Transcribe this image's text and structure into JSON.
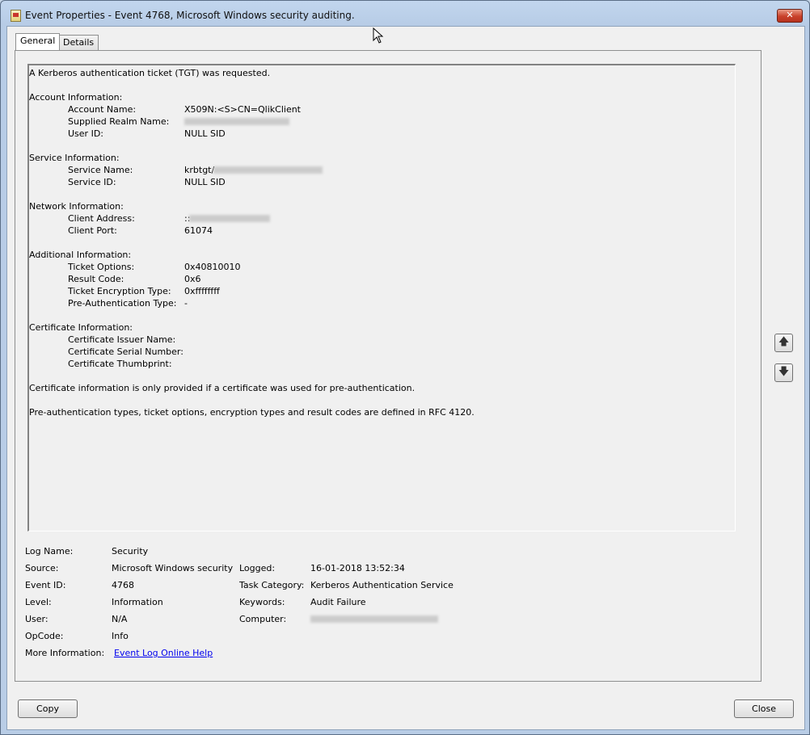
{
  "window": {
    "title": "Event Properties - Event 4768, Microsoft Windows security auditing.",
    "close_glyph": "✕"
  },
  "tabs": [
    "General",
    "Details"
  ],
  "description": {
    "intro": "A Kerberos authentication ticket (TGT) was requested.",
    "account": {
      "heading": "Account Information:",
      "account_name_label": "Account Name:",
      "account_name_value": "X509N:<S>CN=QlikClient",
      "realm_label": "Supplied Realm Name:",
      "user_id_label": "User ID:",
      "user_id_value": "NULL SID"
    },
    "service": {
      "heading": "Service Information:",
      "name_label": "Service Name:",
      "name_value_prefix": "krbtgt/",
      "id_label": "Service ID:",
      "id_value": "NULL SID"
    },
    "network": {
      "heading": "Network Information:",
      "address_label": "Client Address:",
      "address_value_prefix": "::",
      "port_label": "Client Port:",
      "port_value": "61074"
    },
    "additional": {
      "heading": "Additional Information:",
      "ticket_options_label": "Ticket Options:",
      "ticket_options_value": "0x40810010",
      "result_code_label": "Result Code:",
      "result_code_value": "0x6",
      "encryption_label": "Ticket Encryption Type:",
      "encryption_value": "0xffffffff",
      "preauth_label": "Pre-Authentication Type:",
      "preauth_value": "-"
    },
    "certificate": {
      "heading": "Certificate Information:",
      "issuer_label": "Certificate Issuer Name:",
      "serial_label": "Certificate Serial Number:",
      "thumbprint_label": "Certificate Thumbprint:"
    },
    "note1": "Certificate information is only provided if a certificate was used for pre-authentication.",
    "note2": "Pre-authentication types, ticket options, encryption types and result codes are defined in RFC 4120."
  },
  "meta": {
    "log_name_label": "Log Name:",
    "log_name_value": "Security",
    "source_label": "Source:",
    "source_value": "Microsoft Windows security",
    "logged_label": "Logged:",
    "logged_value": "16-01-2018 13:52:34",
    "event_id_label": "Event ID:",
    "event_id_value": "4768",
    "task_category_label": "Task Category:",
    "task_category_value": "Kerberos Authentication Service",
    "level_label": "Level:",
    "level_value": "Information",
    "keywords_label": "Keywords:",
    "keywords_value": "Audit Failure",
    "user_label": "User:",
    "user_value": "N/A",
    "computer_label": "Computer:",
    "opcode_label": "OpCode:",
    "opcode_value": "Info",
    "more_info_label": "More Information:",
    "more_info_link": "Event Log Online Help"
  },
  "buttons": {
    "copy": "Copy",
    "close": "Close",
    "up_glyph": "🡅",
    "down_glyph": "🡇"
  }
}
